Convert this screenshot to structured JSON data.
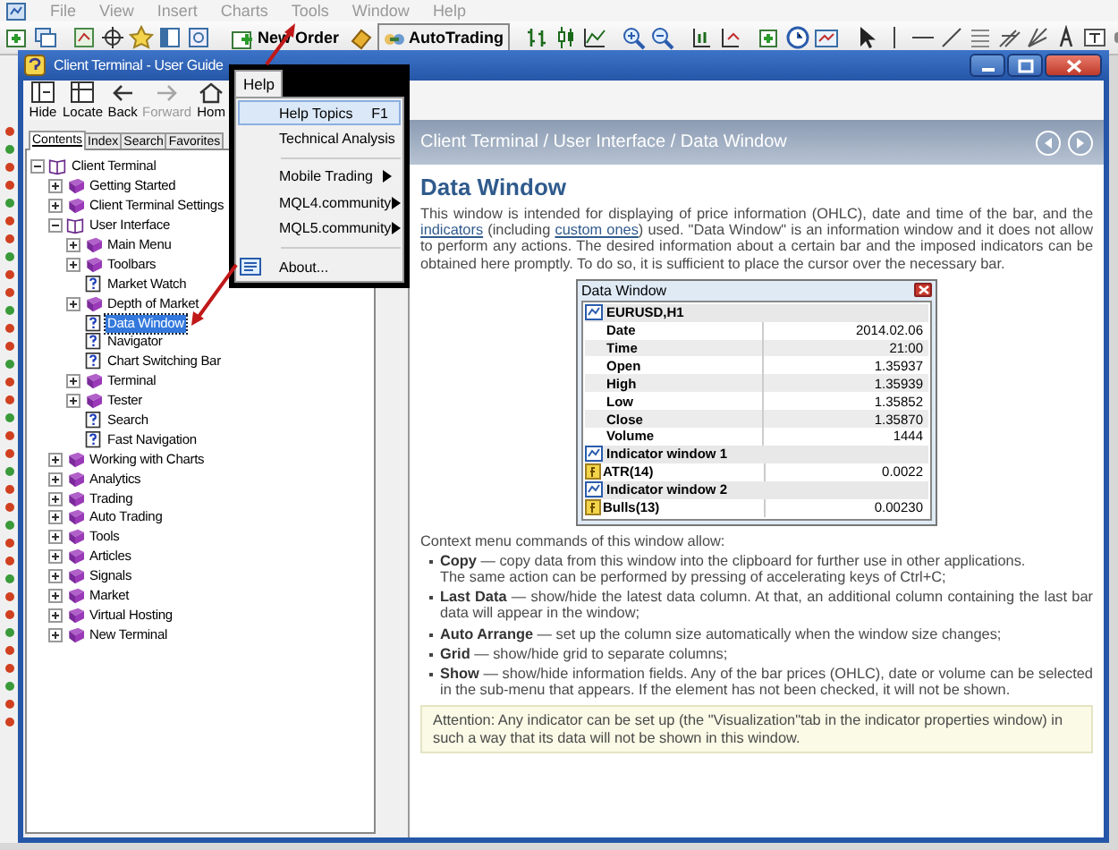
{
  "app_menu": [
    "File",
    "View",
    "Insert",
    "Charts",
    "Tools",
    "Window",
    "Help"
  ],
  "toolbar": {
    "buttons": [
      {
        "label": "New Order"
      },
      {
        "label": "AutoTrading"
      }
    ]
  },
  "help_window": {
    "title": "Client Terminal - User Guide",
    "toolbar": [
      {
        "label": "Hide",
        "disabled": false
      },
      {
        "label": "Locate",
        "disabled": false
      },
      {
        "label": "Back",
        "disabled": false
      },
      {
        "label": "Forward",
        "disabled": true
      },
      {
        "label": "Hom",
        "disabled": false
      }
    ],
    "tabs": [
      {
        "label": "Contents",
        "selected": true
      },
      {
        "label": "Index",
        "selected": false
      },
      {
        "label": "Search",
        "selected": false
      },
      {
        "label": "Favorites",
        "selected": false
      }
    ],
    "tree": [
      {
        "label": "Client Terminal",
        "kind": "book",
        "expanded": true,
        "selected": false,
        "children": [
          {
            "label": "Getting Started",
            "kind": "book",
            "expanded": false,
            "selected": false
          },
          {
            "label": "Client Terminal Settings",
            "kind": "book",
            "expanded": false,
            "selected": false
          },
          {
            "label": "User Interface",
            "kind": "book",
            "expanded": true,
            "selected": false,
            "children": [
              {
                "label": "Main Menu",
                "kind": "book",
                "expanded": false,
                "selected": false
              },
              {
                "label": "Toolbars",
                "kind": "book",
                "expanded": false,
                "selected": false
              },
              {
                "label": "Market Watch",
                "kind": "page",
                "selected": false
              },
              {
                "label": "Depth of Market",
                "kind": "book",
                "expanded": false,
                "selected": false
              },
              {
                "label": "Data Window",
                "kind": "page",
                "selected": true
              },
              {
                "label": "Navigator",
                "kind": "page",
                "selected": false
              },
              {
                "label": "Chart Switching Bar",
                "kind": "page",
                "selected": false
              },
              {
                "label": "Terminal",
                "kind": "book",
                "expanded": false,
                "selected": false
              },
              {
                "label": "Tester",
                "kind": "book",
                "expanded": false,
                "selected": false
              },
              {
                "label": "Search",
                "kind": "page",
                "selected": false
              },
              {
                "label": "Fast Navigation",
                "kind": "page",
                "selected": false
              }
            ]
          },
          {
            "label": "Working with Charts",
            "kind": "book",
            "expanded": false,
            "selected": false
          },
          {
            "label": "Analytics",
            "kind": "book",
            "expanded": false,
            "selected": false
          },
          {
            "label": "Trading",
            "kind": "book",
            "expanded": false,
            "selected": false
          },
          {
            "label": "Auto Trading",
            "kind": "book",
            "expanded": false,
            "selected": false
          },
          {
            "label": "Tools",
            "kind": "book",
            "expanded": false,
            "selected": false
          },
          {
            "label": "Articles",
            "kind": "book",
            "expanded": false,
            "selected": false
          },
          {
            "label": "Signals",
            "kind": "book",
            "expanded": false,
            "selected": false
          },
          {
            "label": "Market",
            "kind": "book",
            "expanded": false,
            "selected": false
          },
          {
            "label": "Virtual Hosting",
            "kind": "book",
            "expanded": false,
            "selected": false
          },
          {
            "label": "New Terminal",
            "kind": "book",
            "expanded": false,
            "selected": false
          }
        ]
      }
    ],
    "breadcrumb": "Client Terminal / User Interface / Data Window",
    "heading": "Data Window",
    "intro": [
      {
        "text": "This window is intended for displaying of price information (OHLC), date and time of the bar, and the ",
        "link": false
      },
      {
        "text": "indicators",
        "link": true
      },
      {
        "text": " (including ",
        "link": false
      },
      {
        "text": "custom ones",
        "link": true
      },
      {
        "text": ") used. \"Data Window\" is an information window and it does not allow to perform any actions. The desired information about a certain bar and the imposed indicators can be obtained here promptly. To do so, it is sufficient to place the cursor over the necessary bar.",
        "link": false
      }
    ],
    "data_window": {
      "title": "Data Window",
      "rows": [
        {
          "kind": "group",
          "label": "EURUSD,H1"
        },
        {
          "kind": "field",
          "label": "Date",
          "value": "2014.02.06"
        },
        {
          "kind": "field",
          "label": "Time",
          "value": "21:00"
        },
        {
          "kind": "field",
          "label": "Open",
          "value": "1.35937"
        },
        {
          "kind": "field",
          "label": "High",
          "value": "1.35939"
        },
        {
          "kind": "field",
          "label": "Low",
          "value": "1.35852"
        },
        {
          "kind": "field",
          "label": "Close",
          "value": "1.35870"
        },
        {
          "kind": "field",
          "label": "Volume",
          "value": "1444"
        },
        {
          "kind": "group",
          "label": "Indicator window 1"
        },
        {
          "kind": "indicator",
          "label": "ATR(14)",
          "value": "0.0022"
        },
        {
          "kind": "group",
          "label": "Indicator window 2"
        },
        {
          "kind": "indicator",
          "label": "Bulls(13)",
          "value": "0.00230"
        }
      ]
    },
    "context_intro": "Context menu commands of this window allow:",
    "commands": [
      {
        "text": "**Copy** — copy data from this window into the clipboard for further use in other applications.",
        "note": "The same action can be performed by pressing of accelerating keys of Ctrl+C;"
      },
      {
        "text": "**Last Data** — show/hide the latest data column. At that, an additional column containing the last bar data will appear in the window;"
      },
      {
        "text": "**Auto Arrange** — set up the column size automatically when the window size changes;"
      },
      {
        "text": "**Grid** — show/hide grid to separate columns;"
      },
      {
        "text": "**Show** — show/hide information fields. Any of the bar prices (OHLC), date or volume can be selected in the sub-menu that appears. If the element has not been checked, it will not be shown."
      }
    ],
    "attention": "Attention: Any indicator can be set up (the \"Visualization\"tab in the indicator properties window) in such a way that its data will not be shown in this window."
  },
  "help_menu": {
    "title": "Help",
    "items": [
      {
        "kind": "item",
        "label": "Help Topics",
        "shortcut": "F1",
        "selected": true,
        "submenu": false
      },
      {
        "kind": "item",
        "label": "Technical Analysis",
        "selected": false,
        "submenu": false
      },
      {
        "kind": "separator"
      },
      {
        "kind": "item",
        "label": "Mobile Trading",
        "selected": false,
        "submenu": true
      },
      {
        "kind": "item",
        "label": "MQL4.community",
        "selected": false,
        "submenu": true
      },
      {
        "kind": "item",
        "label": "MQL5.community",
        "selected": false,
        "submenu": true
      },
      {
        "kind": "separator"
      },
      {
        "kind": "about",
        "label": "About...",
        "selected": false,
        "submenu": false
      }
    ]
  }
}
